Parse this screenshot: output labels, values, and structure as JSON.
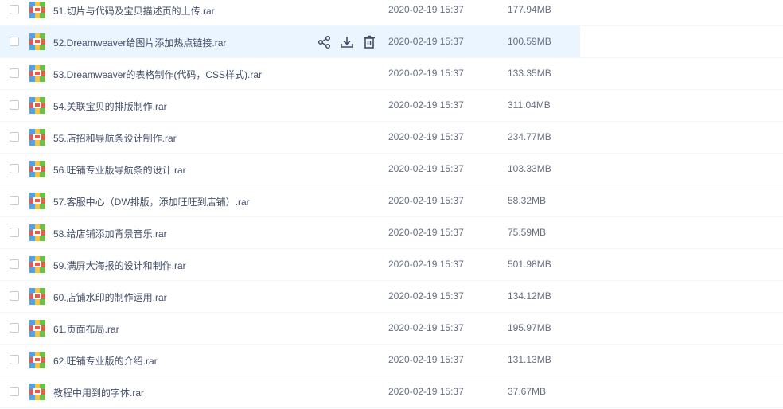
{
  "files": [
    {
      "name": "51.切片与代码及宝贝描述页的上传.rar",
      "date": "2020-02-19 15:37",
      "size": "177.94MB"
    },
    {
      "name": "52.Dreamweaver给图片添加热点链接.rar",
      "date": "2020-02-19 15:37",
      "size": "100.59MB",
      "hovered": true
    },
    {
      "name": "53.Dreamweaver的表格制作(代码，CSS样式).rar",
      "date": "2020-02-19 15:37",
      "size": "133.35MB"
    },
    {
      "name": "54.关联宝贝的排版制作.rar",
      "date": "2020-02-19 15:37",
      "size": "311.04MB"
    },
    {
      "name": "55.店招和导航条设计制作.rar",
      "date": "2020-02-19 15:37",
      "size": "234.77MB"
    },
    {
      "name": "56.旺铺专业版导航条的设计.rar",
      "date": "2020-02-19 15:37",
      "size": "103.33MB"
    },
    {
      "name": "57.客服中心（DW排版，添加旺旺到店铺）.rar",
      "date": "2020-02-19 15:37",
      "size": "58.32MB"
    },
    {
      "name": "58.给店铺添加背景音乐.rar",
      "date": "2020-02-19 15:37",
      "size": "75.59MB"
    },
    {
      "name": "59.满屏大海报的设计和制作.rar",
      "date": "2020-02-19 15:37",
      "size": "501.98MB"
    },
    {
      "name": "60.店铺水印的制作运用.rar",
      "date": "2020-02-19 15:37",
      "size": "134.12MB"
    },
    {
      "name": "61.页面布局.rar",
      "date": "2020-02-19 15:37",
      "size": "195.97MB"
    },
    {
      "name": "62.旺铺专业版的介绍.rar",
      "date": "2020-02-19 15:37",
      "size": "131.13MB"
    },
    {
      "name": "教程中用到的字体.rar",
      "date": "2020-02-19 15:37",
      "size": "37.67MB"
    }
  ],
  "row_actions": [
    "share-icon",
    "download-icon",
    "delete-icon"
  ],
  "colors": {
    "hover": "#ebf5ff",
    "action_icon": "#424e67",
    "text": "#424e67",
    "meta_text": "#666f80"
  }
}
